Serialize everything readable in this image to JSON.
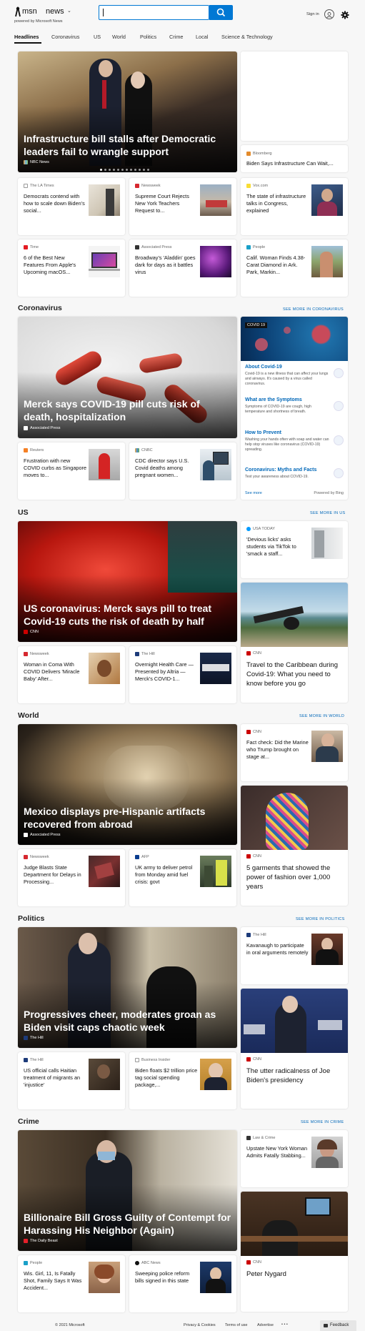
{
  "header": {
    "brand": "msn",
    "section": "news",
    "tagline": "powered by Microsoft News",
    "search_placeholder": "",
    "sign_in": "Sign in"
  },
  "nav": {
    "items": [
      "Headlines",
      "Coronavirus",
      "US",
      "World",
      "Politics",
      "Crime",
      "Local",
      "Science & Technology"
    ],
    "active": "Headlines"
  },
  "top": {
    "hero": {
      "title": "Infrastructure bill stalls after Democratic leaders fail to wrangle support",
      "source": "NBC News"
    },
    "side": {
      "source": "Bloomberg",
      "title": "Biden Says Infrastructure Can Wait,..."
    },
    "cards": [
      {
        "source": "The LA Times",
        "title": "Democrats contend with how to scale down Biden's social..."
      },
      {
        "source": "Newsweek",
        "title": "Supreme Court Rejects New York Teachers Request to..."
      },
      {
        "source": "Vox.com",
        "title": "The state of infrastructure talks in Congress, explained"
      },
      {
        "source": "Time",
        "title": "6 of the Best New Features From Apple's Upcoming macOS..."
      },
      {
        "source": "Associated Press",
        "title": "Broadway's 'Aladdin' goes dark for days as it battles virus"
      },
      {
        "source": "People",
        "title": "Calif. Woman Finds 4.38-Carat Diamond in Ark. Park, Markin..."
      }
    ]
  },
  "coronavirus": {
    "title": "Coronavirus",
    "see_more": "SEE MORE IN CORONAVIRUS",
    "hero": {
      "title": "Merck says COVID-19 pill cuts risk of death, hospitalization",
      "source": "Associated Press"
    },
    "cards": [
      {
        "source": "Reuters",
        "title": "Frustration with new COVID curbs as Singapore moves to..."
      },
      {
        "source": "CNBC",
        "title": "CDC director says U.S. Covid deaths among pregnant women..."
      }
    ],
    "info": {
      "badge": "COVID 19",
      "items": [
        {
          "title": "About Covid-19",
          "desc": "Covid-19 is a new illness that can affect your lungs and airways. It's caused by a virus called coronavirus."
        },
        {
          "title": "What are the Symptoms",
          "desc": "Symptoms of COVID-19 are cough, high temperature and shortness of breath."
        },
        {
          "title": "How to Prevent",
          "desc": "Washing your hands often with soap and water can help stop viruses like coronavirus (COVID-19) spreading."
        },
        {
          "title": "Coronavirus: Myths and Facts",
          "desc": "Test your awareness about COVID-19."
        }
      ],
      "see_more": "See more",
      "powered": "Powered by Bing"
    }
  },
  "us": {
    "title": "US",
    "see_more": "SEE MORE IN US",
    "hero": {
      "title": "US coronavirus: Merck says pill to treat Covid-19 cuts the risk of death by half",
      "source": "CNN"
    },
    "side_top": {
      "source": "USA TODAY",
      "title": "'Devious licks' asks students via TikTok to 'smack a staff..."
    },
    "side_big": {
      "source": "CNN",
      "title": "Travel to the Caribbean during Covid-19: What you need to know before you go"
    },
    "cards": [
      {
        "source": "Newsweek",
        "title": "Woman in Coma With COVID Delivers 'Miracle Baby' After..."
      },
      {
        "source": "The Hill",
        "title": "Overnight Health Care — Presented by Altria — Merck's COVID-1..."
      }
    ]
  },
  "world": {
    "title": "World",
    "see_more": "SEE MORE IN WORLD",
    "hero": {
      "title": "Mexico displays pre-Hispanic artifacts recovered from abroad",
      "source": "Associated Press"
    },
    "side_top": {
      "source": "CNN",
      "title": "Fact check: Did the Marine who Trump brought on stage at..."
    },
    "side_big": {
      "source": "CNN",
      "title": "5 garments that showed the power of fashion over 1,000 years"
    },
    "cards": [
      {
        "source": "Newsweek",
        "title": "Judge Blasts State Department for Delays in Processing..."
      },
      {
        "source": "AFP",
        "title": "UK army to deliver petrol from Monday amid fuel crisis: govt"
      }
    ]
  },
  "politics": {
    "title": "Politics",
    "see_more": "SEE MORE IN POLITICS",
    "hero": {
      "title": "Progressives cheer, moderates groan as Biden visit caps chaotic week",
      "source": "The Hill"
    },
    "side_top": {
      "source": "The Hill",
      "title": "Kavanaugh to participate in oral arguments remotely"
    },
    "side_big": {
      "source": "CNN",
      "title": "The utter radicalness of Joe Biden's presidency"
    },
    "cards": [
      {
        "source": "The Hill",
        "title": "US official calls Haitian treatment of migrants an 'injustice'"
      },
      {
        "source": "Business Insider",
        "title": "Biden floats $2 trillion price tag social spending package,..."
      }
    ]
  },
  "crime": {
    "title": "Crime",
    "see_more": "SEE MORE IN CRIME",
    "hero": {
      "title": "Billionaire Bill Gross Guilty of Contempt for Harassing His Neighbor (Again)",
      "source": "The Daily Beast"
    },
    "side_top": {
      "source": "Law & Crime",
      "title": "Upstate New York Woman Admits Fatally Stabbing..."
    },
    "side_big": {
      "source": "CNN",
      "title": "Peter Nygard"
    },
    "cards": [
      {
        "source": "People",
        "title": "Wis. Girl, 11, Is Fatally Shot, Family Says It Was Accident..."
      },
      {
        "source": "ABC News",
        "title": "Sweeping police reform bills signed in this state"
      }
    ]
  },
  "footer": {
    "copyright": "© 2021 Microsoft",
    "links": [
      "Privacy & Cookies",
      "Terms of use",
      "Advertise"
    ],
    "more": "• • •",
    "feedback": "Feedback"
  },
  "colors": {
    "accent": "#0078d4",
    "link": "#0067b8",
    "cnn": "#cc0000"
  }
}
